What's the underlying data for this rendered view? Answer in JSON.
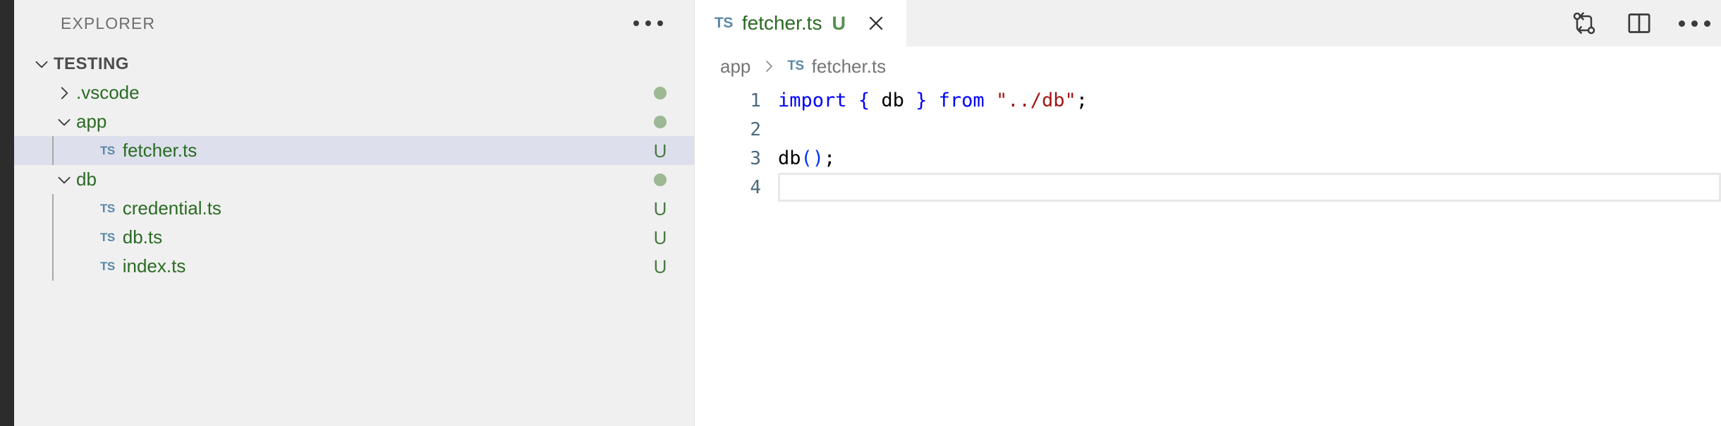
{
  "sidebar": {
    "title": "EXPLORER",
    "more_actions_label": "...",
    "tree": [
      {
        "label": "TESTING",
        "depth": 0,
        "kind": "root",
        "twisty": "down",
        "badge": "",
        "selected": false,
        "untracked": false
      },
      {
        "label": ".vscode",
        "depth": 1,
        "kind": "folder",
        "twisty": "right",
        "badge": "dot",
        "selected": false,
        "untracked": true
      },
      {
        "label": "app",
        "depth": 1,
        "kind": "folder",
        "twisty": "down",
        "badge": "dot",
        "selected": false,
        "untracked": true
      },
      {
        "label": "fetcher.ts",
        "depth": 2,
        "kind": "file",
        "twisty": "none",
        "badge": "U",
        "selected": true,
        "untracked": true
      },
      {
        "label": "db",
        "depth": 1,
        "kind": "folder",
        "twisty": "down",
        "badge": "dot",
        "selected": false,
        "untracked": true
      },
      {
        "label": "credential.ts",
        "depth": 2,
        "kind": "file",
        "twisty": "none",
        "badge": "U",
        "selected": false,
        "untracked": true
      },
      {
        "label": "db.ts",
        "depth": 2,
        "kind": "file",
        "twisty": "none",
        "badge": "U",
        "selected": false,
        "untracked": true
      },
      {
        "label": "index.ts",
        "depth": 2,
        "kind": "file",
        "twisty": "none",
        "badge": "U",
        "selected": false,
        "untracked": true
      }
    ],
    "file_icon_label": "TS"
  },
  "tabs": [
    {
      "icon_label": "TS",
      "label": "fetcher.ts",
      "status": "U",
      "close_label": "close-icon",
      "active": true
    }
  ],
  "editor_actions": [
    {
      "name": "open-changes-icon",
      "label": "Open Changes"
    },
    {
      "name": "split-editor-icon",
      "label": "Split Editor Right"
    },
    {
      "name": "more-actions-icon",
      "label": "..."
    }
  ],
  "breadcrumb": {
    "folder": "app",
    "separator": "›",
    "file_icon_label": "TS",
    "file": "fetcher.ts"
  },
  "code": {
    "language": "typescript",
    "current_line": 4,
    "lines": [
      {
        "number": "1",
        "tokens": [
          {
            "t": "import",
            "c": "kw"
          },
          {
            "t": " ",
            "c": "plain"
          },
          {
            "t": "{",
            "c": "pun"
          },
          {
            "t": " ",
            "c": "plain"
          },
          {
            "t": "db",
            "c": "id"
          },
          {
            "t": " ",
            "c": "plain"
          },
          {
            "t": "}",
            "c": "pun"
          },
          {
            "t": " ",
            "c": "plain"
          },
          {
            "t": "from",
            "c": "kw"
          },
          {
            "t": " ",
            "c": "plain"
          },
          {
            "t": "\"../db\"",
            "c": "str"
          },
          {
            "t": ";",
            "c": "plain"
          }
        ]
      },
      {
        "number": "2",
        "tokens": []
      },
      {
        "number": "3",
        "tokens": [
          {
            "t": "db",
            "c": "id"
          },
          {
            "t": "()",
            "c": "paren"
          },
          {
            "t": ";",
            "c": "plain"
          }
        ]
      },
      {
        "number": "4",
        "tokens": []
      }
    ]
  },
  "colors": {
    "activity_bar": "#2c2c2c",
    "sidebar_bg": "#f0f0f0",
    "selection_bg": "#dde0ec",
    "untracked_green": "#2a6b23",
    "badge_dot_green": "#9cb894",
    "badge_u_green": "#4b7b45",
    "ts_icon_blue": "#5a88a8",
    "keyword_blue": "#0000ff",
    "string_red": "#a31515",
    "line_number": "#4a6a7d",
    "editor_bg": "#ffffff"
  }
}
